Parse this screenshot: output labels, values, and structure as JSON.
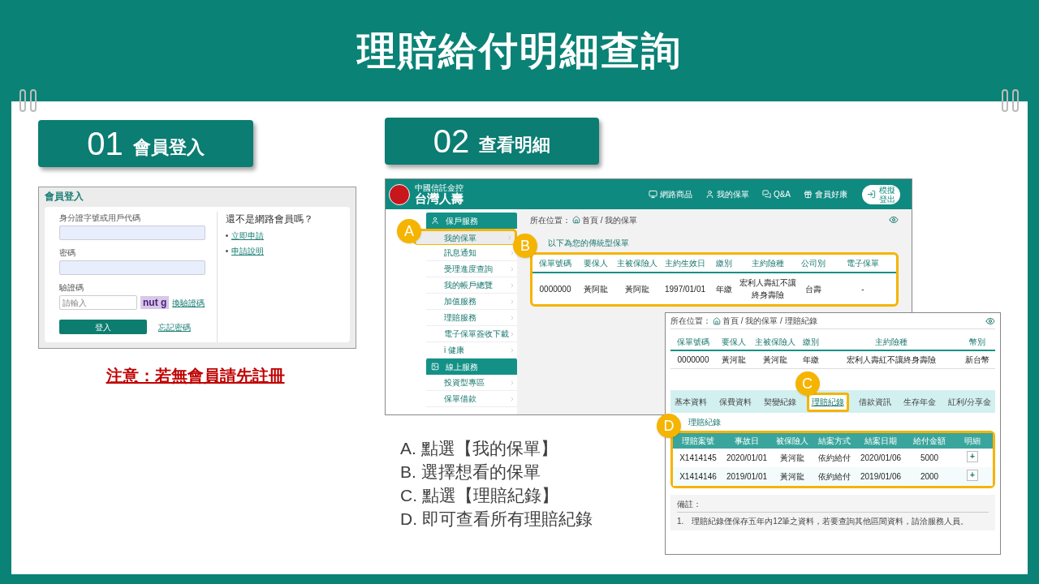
{
  "title": "理賠給付明細查詢",
  "steps": [
    {
      "number": "01",
      "label": "會員登入"
    },
    {
      "number": "02",
      "label": "查看明細"
    }
  ],
  "login": {
    "title": "會員登入",
    "fields": [
      {
        "label": "身分證字號或用戶代碼"
      },
      {
        "label": "密碼"
      }
    ],
    "captcha": {
      "label": "驗證碼",
      "placeholder": "請輸入",
      "image_text": "nut g",
      "refresh_link": "換驗證碼"
    },
    "login_button": "登入",
    "forgot_link": "忘記密碼",
    "signup": {
      "heading": "還不是網路會員嗎？",
      "links": [
        "立即申請",
        "申請說明"
      ]
    }
  },
  "note": "注意：若無會員請先註冊",
  "portal": {
    "brand_sub": "中國信託金控",
    "brand": "台灣人壽",
    "nav": [
      "網路商品",
      "我的保單",
      "Q&A",
      "會員好康"
    ],
    "logout_button": "模擬登出",
    "sidebar": [
      {
        "kind": "header",
        "label": "保戶服務"
      },
      {
        "kind": "item",
        "label": "我的保單",
        "selected": true,
        "callout": "A"
      },
      {
        "kind": "item",
        "label": "訊息通知",
        "selected": false
      },
      {
        "kind": "item",
        "label": "受理進度查詢",
        "selected": false
      },
      {
        "kind": "item",
        "label": "我的帳戶總覽",
        "selected": false
      },
      {
        "kind": "item",
        "label": "加值服務",
        "selected": false
      },
      {
        "kind": "item",
        "label": "理賠服務",
        "selected": false
      },
      {
        "kind": "item",
        "label": "電子保單簽收下載",
        "selected": false
      },
      {
        "kind": "item",
        "label": "i 健康",
        "selected": false
      },
      {
        "kind": "header",
        "label": "線上服務"
      },
      {
        "kind": "item",
        "label": "投資型專區",
        "selected": false
      },
      {
        "kind": "item",
        "label": "保單借款",
        "selected": false
      }
    ],
    "breadcrumb": {
      "prefix": "所在位置：",
      "path": "首頁 / 我的保單"
    },
    "caption": "以下為您的傳統型保單",
    "policy_table": {
      "callout": "B",
      "columns": [
        "保單號碼",
        "要保人",
        "主被保險人",
        "主約生效日",
        "繳別",
        "主約險種",
        "公司別",
        "電子保單"
      ],
      "rows": [
        [
          "0000000",
          "黃阿龍",
          "黃阿龍",
          "1997/01/01",
          "年繳",
          "宏利人壽紅不讓終身壽險",
          "台壽",
          "-"
        ]
      ]
    }
  },
  "claims": {
    "breadcrumb": {
      "prefix": "所在位置：",
      "path": "首頁 / 我的保單 / 理賠紀錄"
    },
    "policy_table": {
      "columns": [
        "保單號碼",
        "要保人",
        "主被保險人",
        "繳別",
        "主約險種",
        "幣別"
      ],
      "rows": [
        [
          "0000000",
          "黃河龍",
          "黃河龍",
          "年繳",
          "宏利人壽紅不讓終身壽險",
          "新台幣"
        ]
      ]
    },
    "tabs": [
      {
        "label": "基本資料",
        "selected": false
      },
      {
        "label": "保費資料",
        "selected": false
      },
      {
        "label": "契變紀錄",
        "selected": false
      },
      {
        "label": "理賠紀錄",
        "selected": true,
        "callout": "C"
      },
      {
        "label": "借款資訊",
        "selected": false
      },
      {
        "label": "生存年金",
        "selected": false
      },
      {
        "label": "紅利/分享金",
        "selected": false
      }
    ],
    "section_title": "理賠紀錄",
    "claims_table": {
      "callout": "D",
      "columns": [
        "理賠案號",
        "事故日",
        "被保險人",
        "結案方式",
        "結案日期",
        "給付金額",
        "明細"
      ],
      "rows": [
        [
          "X1414145",
          "2020/01/01",
          "黃河龍",
          "依約給付",
          "2020/01/06",
          "5000",
          "+"
        ],
        [
          "X1414146",
          "2019/01/01",
          "黃河龍",
          "依約給付",
          "2019/01/06",
          "2000",
          "+"
        ]
      ]
    },
    "remarks": {
      "heading": "備註：",
      "items": [
        {
          "number": "1.",
          "text": "理賠紀錄僅保存五年內12筆之資料，若要查詢其他區間資料，請洽服務人員。"
        }
      ]
    }
  },
  "instructions": [
    "A. 點選【我的保單】",
    "B. 選擇想看的保單",
    "C. 點選【理賠紀錄】",
    "D. 即可查看所有理賠紀錄"
  ]
}
